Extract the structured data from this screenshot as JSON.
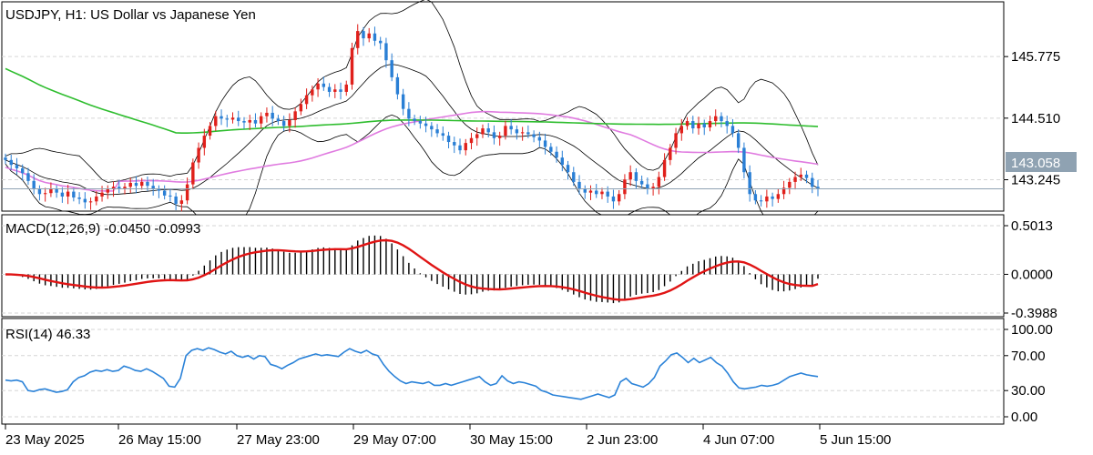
{
  "colors": {
    "bull": "#e0201b",
    "bear": "#2a7fd5",
    "ma_slow": "#2ebd2e",
    "ma_fast": "#e07be0",
    "bands": "#000000",
    "macd_signal": "#e01414",
    "rsi_line": "#2a82d8",
    "grid": "#d6d6d6",
    "price_tag_bg": "#8fa2b2"
  },
  "chart_data": [
    {
      "type": "candlestick",
      "title": "USDJPY, H1:  US Dollar vs Japanese Yen",
      "symbol": "USDJPY",
      "timeframe": "H1",
      "ylim": [
        142.6,
        146.9
      ],
      "yticks": [
        143.245,
        144.51,
        145.775
      ],
      "current_price": 143.058,
      "current_price_label": "143.058",
      "overlays": [
        "Bollinger Bands",
        "Moving Average (fast)",
        "Moving Average (slow)"
      ],
      "close_series": [
        143.65,
        143.55,
        143.48,
        143.38,
        143.22,
        143.05,
        142.95,
        142.97,
        143.05,
        142.98,
        142.9,
        143.0,
        142.88,
        142.85,
        142.78,
        142.8,
        142.9,
        142.98,
        143.05,
        143.1,
        143.05,
        143.1,
        143.18,
        143.12,
        143.2,
        143.12,
        143.05,
        143.02,
        142.92,
        142.9,
        142.75,
        142.82,
        143.15,
        143.6,
        143.9,
        144.15,
        144.35,
        144.55,
        144.5,
        144.48,
        144.52,
        144.45,
        144.42,
        144.47,
        144.4,
        144.55,
        144.62,
        144.5,
        144.45,
        144.35,
        144.47,
        144.65,
        144.8,
        144.98,
        145.1,
        145.22,
        145.15,
        145.05,
        145.1,
        145.05,
        145.2,
        145.95,
        146.3,
        146.15,
        146.25,
        146.1,
        146.05,
        145.7,
        145.35,
        145.0,
        144.7,
        144.5,
        144.45,
        144.4,
        144.35,
        144.28,
        144.2,
        144.15,
        144.02,
        143.95,
        143.85,
        144.0,
        144.1,
        144.18,
        144.3,
        144.22,
        144.1,
        144.15,
        144.35,
        144.28,
        144.2,
        144.22,
        144.18,
        144.12,
        144.05,
        143.92,
        143.82,
        143.7,
        143.55,
        143.4,
        143.2,
        143.05,
        142.98,
        143.02,
        142.95,
        143.0,
        142.9,
        142.8,
        142.95,
        143.25,
        143.4,
        143.22,
        143.15,
        143.05,
        143.1,
        143.3,
        143.65,
        143.9,
        144.2,
        144.35,
        144.45,
        144.3,
        144.4,
        144.32,
        144.45,
        144.55,
        144.45,
        144.35,
        144.2,
        143.9,
        143.4,
        142.95,
        142.82,
        142.8,
        142.9,
        142.85,
        142.95,
        143.08,
        143.2,
        143.3,
        143.35,
        143.28,
        143.1,
        143.06
      ],
      "macd_value_labels": [
        "-0.0450",
        "-0.0993"
      ],
      "rsi_value_label": "46.33"
    },
    {
      "type": "bar",
      "title": "MACD(12,26,9) -0.0450 -0.0993",
      "ylim": [
        -0.3988,
        0.5013
      ],
      "yticks": [
        0.5013,
        0.0,
        -0.3988
      ],
      "ytick_labels": [
        "0.5013",
        "0.0000",
        "-0.3988"
      ],
      "series": [
        {
          "values": [
            -0.045
          ]
        },
        {
          "values": [
            -0.0993
          ]
        }
      ]
    },
    {
      "type": "line",
      "title": "RSI(14) 46.33",
      "ylim": [
        0,
        100
      ],
      "yticks": [
        100,
        70,
        30,
        0
      ],
      "ytick_labels": [
        "100.00",
        "70.00",
        "30.00",
        "0.00"
      ],
      "series": [
        {
          "values": [
            42,
            41,
            42,
            40,
            30,
            29,
            31,
            32,
            30,
            28,
            29,
            31,
            40,
            45,
            47,
            51,
            53,
            52,
            54,
            52,
            53,
            58,
            56,
            53,
            52,
            55,
            52,
            48,
            44,
            35,
            34,
            44,
            70,
            76,
            78,
            76,
            79,
            77,
            74,
            72,
            75,
            70,
            68,
            70,
            66,
            70,
            69,
            60,
            58,
            55,
            59,
            62,
            66,
            68,
            70,
            72,
            70,
            71,
            70,
            69,
            74,
            78,
            75,
            73,
            76,
            72,
            70,
            60,
            52,
            46,
            41,
            38,
            40,
            39,
            38,
            40,
            36,
            36,
            38,
            36,
            38,
            40,
            42,
            44,
            46,
            40,
            36,
            38,
            47,
            41,
            38,
            40,
            39,
            37,
            35,
            30,
            28,
            25,
            24,
            23,
            22,
            21,
            20,
            22,
            24,
            26,
            24,
            22,
            25,
            40,
            44,
            38,
            36,
            34,
            38,
            45,
            58,
            64,
            71,
            73,
            68,
            62,
            67,
            62,
            65,
            68,
            62,
            58,
            50,
            40,
            33,
            32,
            33,
            34,
            36,
            35,
            36,
            38,
            42,
            46,
            48,
            50,
            48,
            47,
            46
          ]
        }
      ],
      "xtick_labels": [
        "23 May 2025",
        "26 May 15:00",
        "27 May 23:00",
        "29 May 07:00",
        "30 May 15:00",
        "2 Jun 23:00",
        "4 Jun 07:00",
        "5 Jun 15:00"
      ]
    }
  ]
}
